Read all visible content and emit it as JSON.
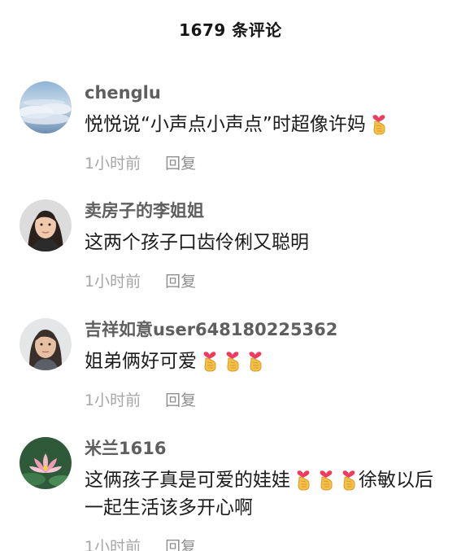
{
  "header": {
    "title": "1679 条评论"
  },
  "comments": [
    {
      "username": "chenglu",
      "text": "悦悦说“小声点小声点”时超像许妈",
      "emoji_after": 1,
      "text_after": "",
      "time": "1小时前",
      "reply_label": "回复",
      "avatar_icon": "sky-clouds-avatar"
    },
    {
      "username": "卖房子的李姐姐",
      "text": "这两个孩子口齿伶俐又聪明",
      "emoji_after": 0,
      "text_after": "",
      "time": "1小时前",
      "reply_label": "回复",
      "avatar_icon": "woman-portrait-avatar"
    },
    {
      "username": "吉祥如意user648180225362",
      "text": "姐弟俩好可爱",
      "emoji_after": 3,
      "text_after": "",
      "time": "1小时前",
      "reply_label": "回复",
      "avatar_icon": "woman-portrait-avatar"
    },
    {
      "username": "米兰1616",
      "text": "这俩孩子真是可爱的娃娃",
      "emoji_after": 3,
      "text_after": "徐敏以后一起生活该多开心啊",
      "time": "1小时前",
      "reply_label": "回复",
      "avatar_icon": "lotus-flower-avatar"
    }
  ],
  "emoji": {
    "name": "finger-heart-emoji",
    "hand_color": "#f4c04a",
    "heart_color": "#ef3b5d"
  }
}
